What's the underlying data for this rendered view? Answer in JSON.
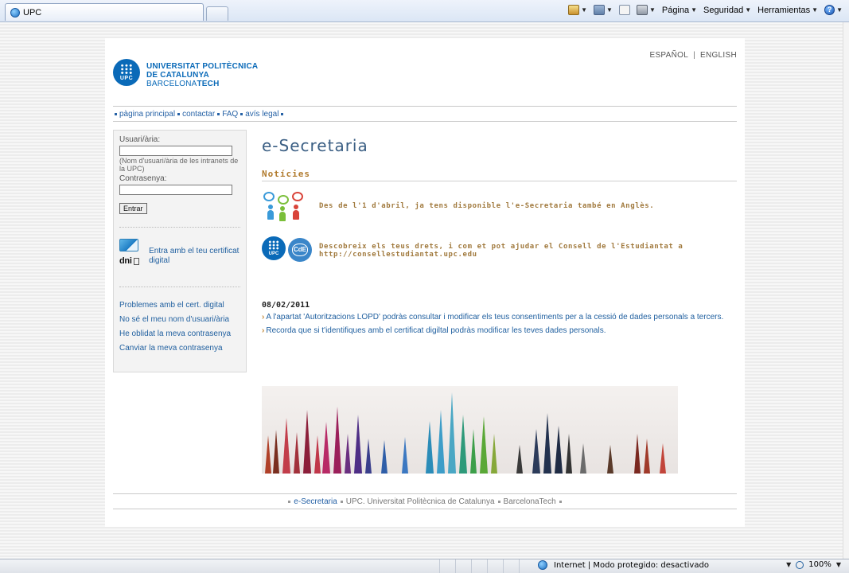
{
  "browser": {
    "tab_title": "UPC",
    "commands": {
      "page": "Página",
      "security": "Seguridad",
      "tools": "Herramientas"
    },
    "status_zone": "Internet | Modo protegido: desactivado",
    "zoom": "100%"
  },
  "header": {
    "logo_line1": "UNIVERSITAT POLITÈCNICA",
    "logo_line2": "DE CATALUNYA",
    "logo_line3_a": "BARCELONA",
    "logo_line3_b": "TECH",
    "logo_badge": "UPC",
    "lang_es": "ESPAÑOL",
    "lang_sep": "|",
    "lang_en": "ENGLISH"
  },
  "nav": {
    "items": [
      "pàgina principal",
      "contactar",
      "FAQ",
      "avís legal"
    ]
  },
  "login": {
    "user_label": "Usuari/ària:",
    "user_value": "",
    "user_hint": "(Nom d'usuari/ària de les intranets de la UPC)",
    "password_label": "Contrasenya:",
    "password_value": "",
    "submit": "Entrar",
    "dni_text": "dni",
    "cert_text": "Entra amb el teu certificat digital",
    "links": [
      "Problemes amb el cert. digital",
      "No sé el meu nom d'usuari/ària",
      "He oblidat la meva contrasenya",
      "Canviar la meva contrasenya"
    ]
  },
  "main": {
    "title": "e-Secretaria",
    "news_heading": "Notícies",
    "news1": "Des de l'1 d'abril, ja tens disponible l'e-Secretaria també en Anglès.",
    "news2_line1": "Descobreix els teus drets, i com et pot ajudar el Consell de l'Estudiantat a",
    "news2_line2": "http://consellestudiantat.upc.edu",
    "news2_badge1": "UPC",
    "news2_badge2": "CdE",
    "date": "08/02/2011",
    "bullet1": "A l'apartat 'Autoritzacions LOPD' podràs consultar i modificar els teus consentiments per a la cessió de dades personals a tercers.",
    "bullet2": "Recorda que si t'identifiques amb el certificat digiltal podràs modificar les teves dades personals."
  },
  "footer": {
    "link1": "e-Secretaria",
    "text2": "UPC. Universitat Politècnica de Catalunya",
    "text3": "BarcelonaTech"
  },
  "colors": {
    "upc_blue": "#0a6ab8",
    "news_gold": "#a17a3e",
    "link_blue": "#1f5f9f"
  }
}
